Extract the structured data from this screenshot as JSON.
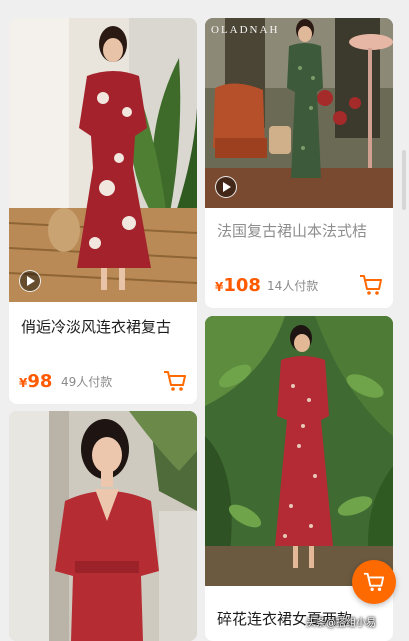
{
  "products": [
    {
      "title": "俏逅冷淡风连衣裙复古",
      "currency": "¥",
      "price": "98",
      "paid": "49人付款",
      "has_video": true,
      "accent_color": "#a3222b"
    },
    {
      "brand_overlay": "OLADNAH",
      "title": "法国复古裙山本法式桔",
      "currency": "¥",
      "price": "108",
      "paid": "14人付款",
      "has_video": true,
      "accent_color": "#3d5a3b"
    },
    {
      "title": "",
      "accent_color": "#b52d33"
    },
    {
      "title": "碎花连衣裙女夏两款",
      "accent_color": "#b42a35"
    }
  ],
  "floating_cart_icon": "shopping-cart-icon",
  "watermark": "头条@搭组小易",
  "colors": {
    "price": "#ff5a00",
    "fab": "#ff6a00",
    "background": "#efefef"
  }
}
